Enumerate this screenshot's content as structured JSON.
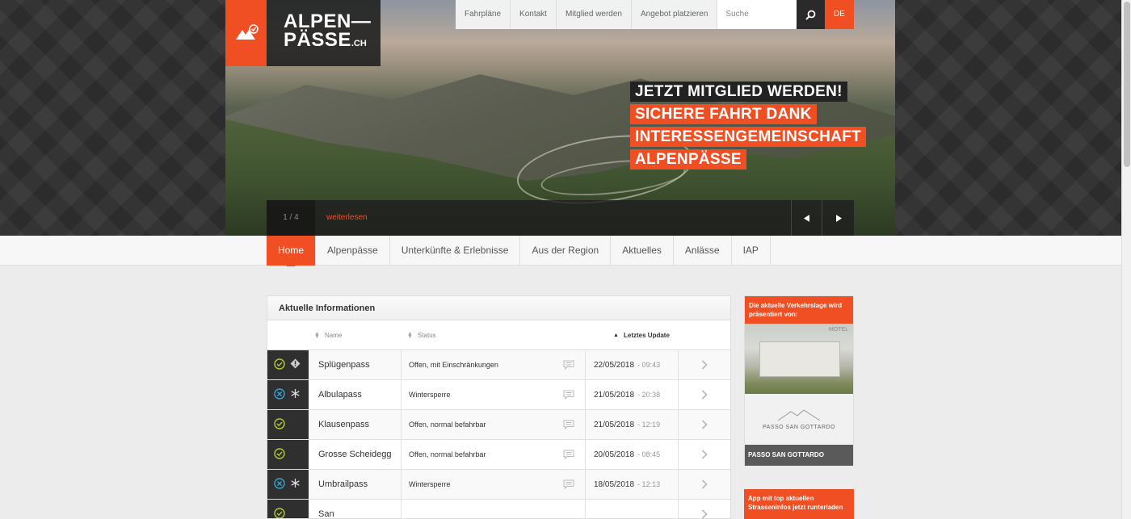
{
  "brand": {
    "line1": "ALPEN—",
    "line2": "PÄSSE",
    "suffix": ".CH"
  },
  "topnav": {
    "links": [
      "Fahrpläne",
      "Kontakt",
      "Mitglied werden",
      "Angebot platzieren"
    ],
    "search_placeholder": "Suche",
    "language": "DE"
  },
  "hero": {
    "claim_dark": "JETZT MITGLIED WERDEN!",
    "claim_lines": [
      "SICHERE FAHRT DANK",
      "INTERESSENGEMEINSCHAFT",
      "ALPENPÄSSE"
    ],
    "counter": "1 / 4",
    "read_more": "weiterlesen"
  },
  "mainnav": {
    "items": [
      "Home",
      "Alpenpässe",
      "Unterkünfte & Erlebnisse",
      "Aus der Region",
      "Aktuelles",
      "Anlässe",
      "IAP"
    ],
    "active": "Home"
  },
  "info": {
    "title": "Aktuelle Informationen",
    "columns": {
      "name": "Name",
      "status": "Status",
      "updated": "Letztes Update"
    },
    "rows": [
      {
        "name": "Splügenpass",
        "status": "Offen, mit Einschränkungen",
        "date": "22/05/2018",
        "time": "- 09:43",
        "state": "open",
        "extra": "warning"
      },
      {
        "name": "Albulapass",
        "status": "Wintersperre",
        "date": "21/05/2018",
        "time": "- 20:38",
        "state": "closed",
        "extra": "snow"
      },
      {
        "name": "Klausenpass",
        "status": "Offen, normal befahrbar",
        "date": "21/05/2018",
        "time": "- 12:19",
        "state": "open",
        "extra": ""
      },
      {
        "name": "Grosse Scheidegg",
        "status": "Offen, normal befahrbar",
        "date": "20/05/2018",
        "time": "- 08:45",
        "state": "open",
        "extra": ""
      },
      {
        "name": "Umbrailpass",
        "status": "Wintersperre",
        "date": "18/05/2018",
        "time": "- 12:13",
        "state": "closed",
        "extra": "snow"
      },
      {
        "name": "San",
        "status": "",
        "date": "",
        "time": "",
        "state": "open",
        "extra": ""
      }
    ]
  },
  "sidebar": {
    "ad_heading": "Die aktuelle Verkehrslage wird präsentiert von:",
    "ad_photo_label": "MOTEL",
    "ad_logo_text": "PASSO SAN GOTTARDO",
    "ad_footer": "PASSO SAN GOTTARDO",
    "app_teaser": "App mit top aktuellen Strasseninfos jetzt runterladen"
  },
  "colors": {
    "accent": "#f04e23",
    "dark": "#2f2f2f",
    "open": "#b5c934",
    "closed": "#37a3d6"
  }
}
